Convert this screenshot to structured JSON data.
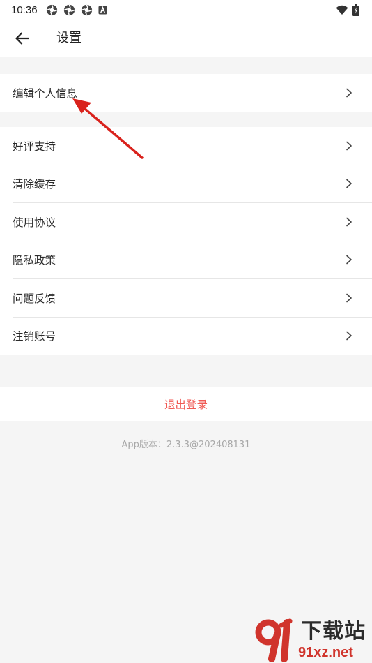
{
  "status_bar": {
    "time": "10:36",
    "notification_icons": [
      "aperture-icon",
      "aperture-icon",
      "aperture-icon",
      "a-badge-icon"
    ],
    "right_icons": [
      "wifi-icon",
      "battery-charging-icon"
    ]
  },
  "header": {
    "back_icon": "arrow-left-icon",
    "title": "设置"
  },
  "groups": [
    {
      "items": [
        {
          "label": "编辑个人信息"
        }
      ]
    },
    {
      "items": [
        {
          "label": "好评支持"
        },
        {
          "label": "清除缓存"
        },
        {
          "label": "使用协议"
        },
        {
          "label": "隐私政策"
        },
        {
          "label": "问题反馈"
        },
        {
          "label": "注销账号"
        }
      ]
    }
  ],
  "logout": {
    "label": "退出登录"
  },
  "version": {
    "text": "App版本：2.3.3@202408131"
  },
  "watermark": {
    "title": "下载站",
    "domain": "91xz.net"
  },
  "colors": {
    "background": "#f5f5f5",
    "surface": "#ffffff",
    "divider": "#e6e6e6",
    "text": "#222222",
    "danger": "#f05a54",
    "muted": "#a8a8a8",
    "annotation": "#d9221c"
  }
}
